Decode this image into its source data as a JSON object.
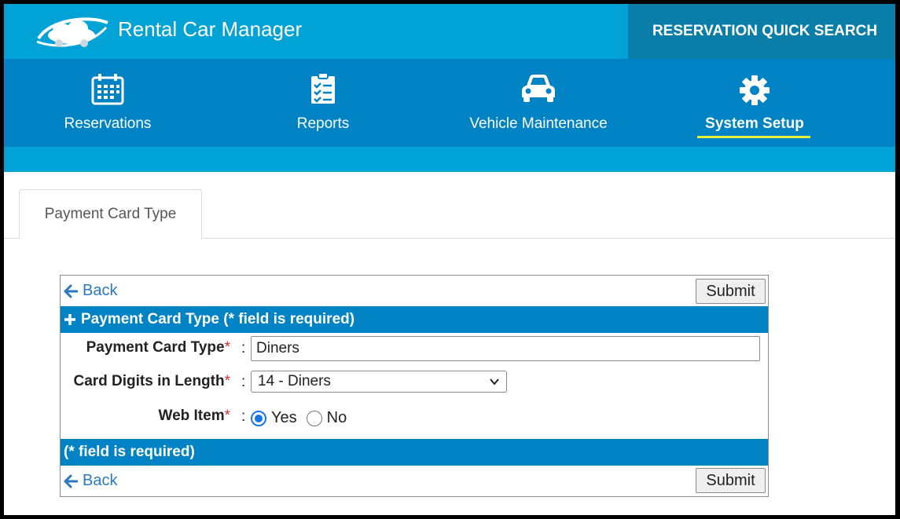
{
  "header": {
    "app_title": "Rental Car Manager",
    "quick_search_label": "RESERVATION QUICK SEARCH"
  },
  "nav": {
    "items": [
      {
        "label": "Reservations",
        "icon": "calendar-icon"
      },
      {
        "label": "Reports",
        "icon": "clipboard-checklist-icon"
      },
      {
        "label": "Vehicle Maintenance",
        "icon": "car-icon"
      },
      {
        "label": "System Setup",
        "icon": "gear-icon",
        "active": true
      }
    ]
  },
  "tab": {
    "label": "Payment Card Type"
  },
  "form": {
    "back_label": "Back",
    "submit_label": "Submit",
    "section_title": "Payment Card Type (* field is required)",
    "footer_note": "(* field is required)",
    "fields": {
      "card_type": {
        "label": "Payment Card Type",
        "value": "Diners"
      },
      "digits": {
        "label": "Card Digits in Length",
        "value": "14 - Diners"
      },
      "web_item": {
        "label": "Web Item",
        "options": [
          "Yes",
          "No"
        ],
        "selected": "Yes"
      }
    },
    "required_mark": "*",
    "colon": ":"
  },
  "colors": {
    "topbar": "#01a2d5",
    "navbar": "#0083c5",
    "quick_search_bg": "#0a7ea8",
    "active_underline": "#e6f23a",
    "link": "#2a78bf"
  }
}
